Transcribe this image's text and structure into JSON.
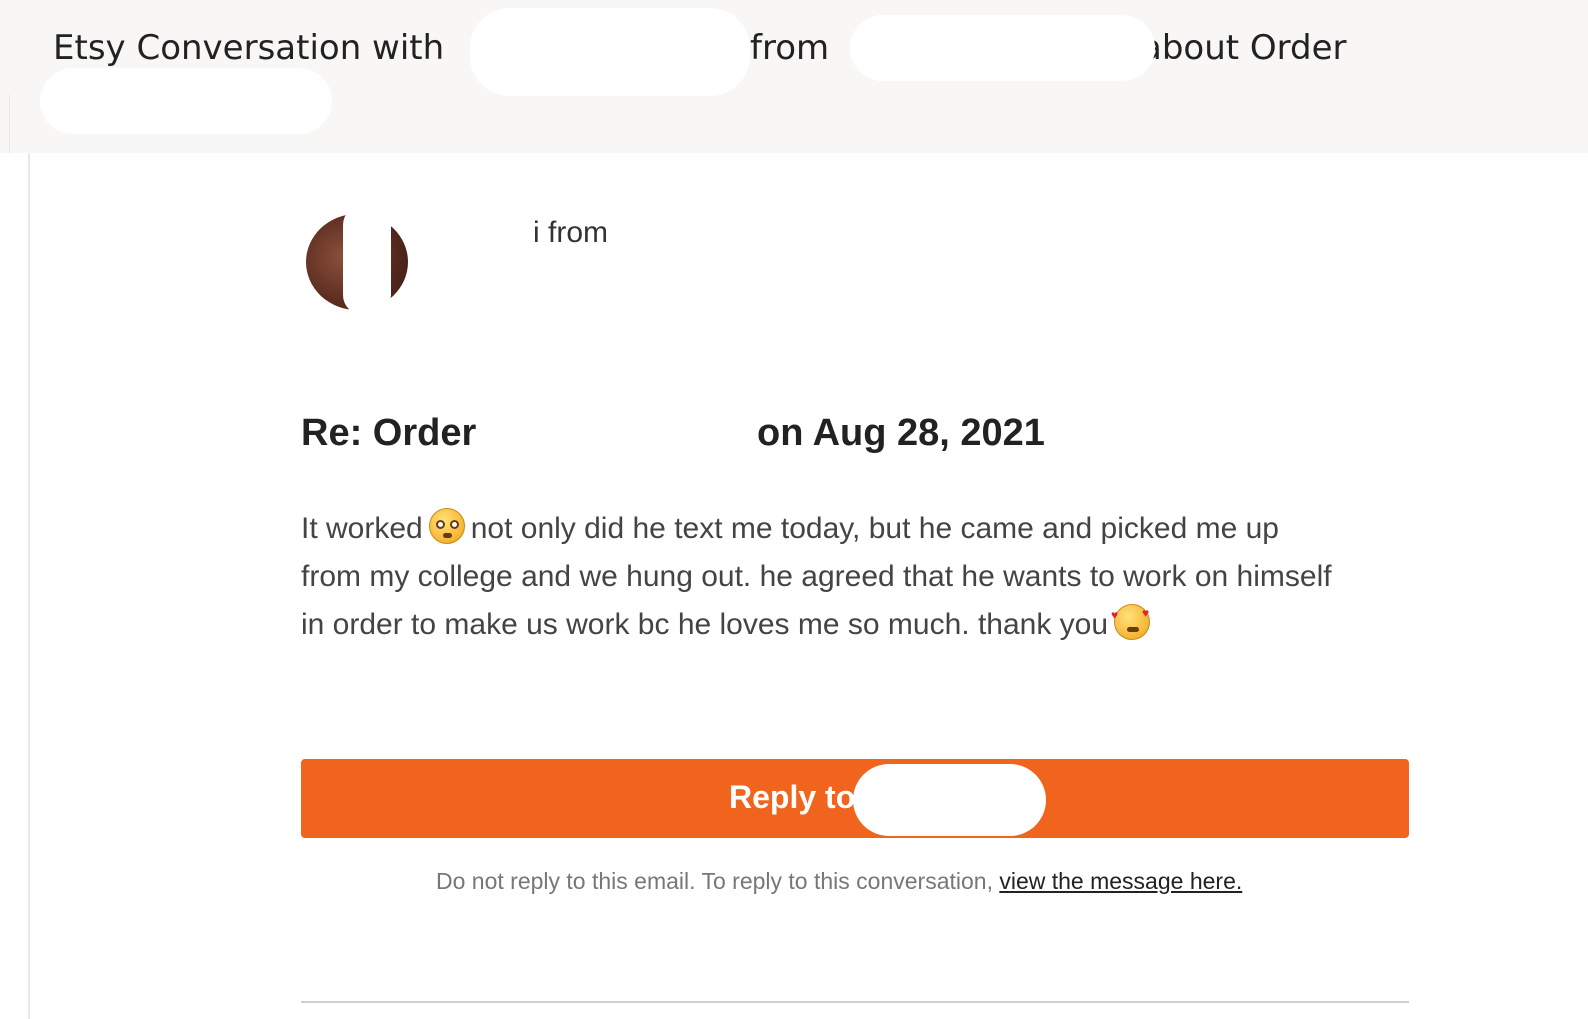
{
  "header": {
    "subject_part1": "Etsy Conversation with",
    "subject_part2": "from",
    "subject_part3": "about Order"
  },
  "sender": {
    "line": "i from"
  },
  "message": {
    "title_prefix": "Re: Order",
    "title_suffix": "on Aug 28, 2021",
    "line1_a": "It worked",
    "line1_b": "not only did he text me today, but he came and picked me up",
    "line2": "from my college and we hung out. he agreed that he wants to work on himself",
    "line3": "in order to make us work bc he loves me so much. thank you",
    "emoji_1": "flushed-face-icon",
    "emoji_2": "smiling-face-with-hearts-icon"
  },
  "reply": {
    "button_label": "Reply to",
    "button_color": "#f1641e"
  },
  "footer": {
    "note": "Do not reply to this email. To reply to this conversation,",
    "link": "view the message here."
  }
}
